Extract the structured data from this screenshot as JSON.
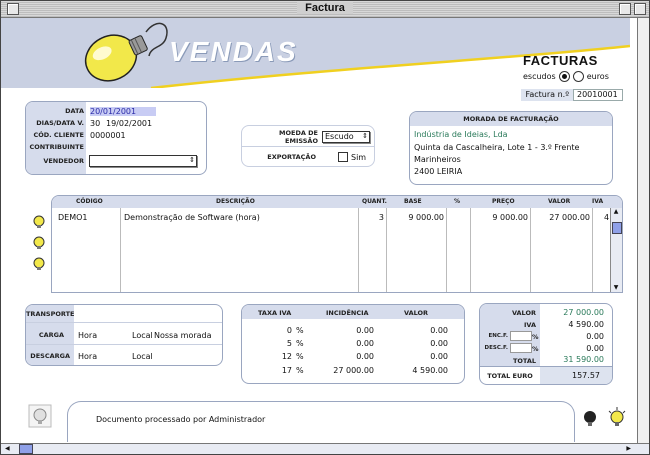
{
  "window": {
    "title": "Factura"
  },
  "header": {
    "app_title": "VENDAS",
    "doc_type": "FACTURAS",
    "currency_escudos": "escudos",
    "currency_euros": "euros",
    "invoice_label": "Factura n.º",
    "invoice_number": "20010001"
  },
  "info": {
    "data_label": "DATA",
    "data_value": "20/01/2001",
    "dias_label": "DIAS/DATA V.",
    "dias_value": "30",
    "data_venc": "19/02/2001",
    "cliente_label": "CÓD. CLIENTE",
    "cliente_value": "0000001",
    "contribuinte_label": "CONTRIBUINTE",
    "contribuinte_value": "",
    "vendedor_label": "VENDEDOR",
    "vendedor_value": ""
  },
  "moeda": {
    "label": "MOEDA DE EMISSÃO",
    "value": "Escudo",
    "export_label": "EXPORTAÇÃO",
    "sim_label": "Sim"
  },
  "morada": {
    "title": "MORADA DE FACTURAÇÃO",
    "company": "Indústria de Ideias, Lda",
    "line1": "Quinta da Cascalheira, Lote 1 - 3.º Frente",
    "line2": "Marinheiros",
    "line3": "2400 LEIRIA"
  },
  "lines": {
    "headers": {
      "codigo": "CÓDIGO",
      "descricao": "DESCRIÇÃO",
      "quant": "QUANT.",
      "base": "BASE",
      "pct": "%",
      "preco": "PREÇO",
      "valor": "VALOR",
      "iva": "IVA"
    },
    "rows": [
      {
        "codigo": "DEMO1",
        "descricao": "Demonstração de Software (hora)",
        "quant": "3",
        "base": "9 000.00",
        "pct": "",
        "preco": "9 000.00",
        "valor": "27 000.00",
        "iva": "4"
      }
    ]
  },
  "transport": {
    "transporte_label": "TRANSPORTE",
    "carga_label": "CARGA",
    "carga_time": "Hora",
    "carga_local_label": "Local",
    "carga_local": "Nossa morada",
    "descarga_label": "DESCARGA",
    "descarga_time": "Hora",
    "descarga_local_label": "Local",
    "descarga_local": ""
  },
  "iva_table": {
    "headers": {
      "taxa": "TAXA IVA",
      "incidencia": "INCIDÊNCIA",
      "valor": "VALOR"
    },
    "rows": [
      {
        "taxa": "0",
        "pct": "%",
        "incidencia": "0.00",
        "valor": "0.00"
      },
      {
        "taxa": "5",
        "pct": "%",
        "incidencia": "0.00",
        "valor": "0.00"
      },
      {
        "taxa": "12",
        "pct": "%",
        "incidencia": "0.00",
        "valor": "0.00"
      },
      {
        "taxa": "17",
        "pct": "%",
        "incidencia": "27 000.00",
        "valor": "4 590.00"
      }
    ]
  },
  "totals": {
    "valor_label": "VALOR",
    "valor": "27 000.00",
    "iva_label": "IVA",
    "iva": "4 590.00",
    "encf_label": "ENC.F.",
    "encf_pct": "%",
    "encf": "0.00",
    "descf_label": "DESC.F.",
    "descf_pct": "%",
    "descf": "0.00",
    "total_label": "TOTAL",
    "total": "31 590.00",
    "total_euro_label": "TOTAL EURO",
    "total_euro": "157.57"
  },
  "status": {
    "message": "Documento processado por Administrador"
  },
  "colors": {
    "accent_blue": "#2a2aa8",
    "panel_label_bg": "#d6dcec",
    "header_band": "#c9d0e2",
    "bulb_yellow": "#f2e84a"
  }
}
